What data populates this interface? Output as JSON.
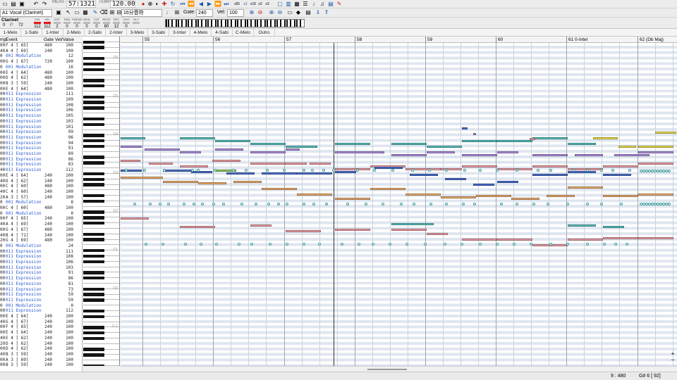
{
  "toolbar": {
    "measure": "57:1321",
    "tempo_label": "TEMPO",
    "tempo": "120.00",
    "meas_label": "MEAS",
    "step_select": "16分音符",
    "gate_label": "Gate:",
    "gate": "240",
    "vel_label": "Vel:",
    "vel": "100",
    "zoom_a": "x65",
    "zoom_b": "x1",
    "zoom_c": "x15",
    "zoom_d": "x2",
    "zoom_e": "x3"
  },
  "track": {
    "select": "A1 Vocal (Clarinet)",
    "name": "Clarinet",
    "num": "0",
    "port": "72",
    "meter_heads": [
      "VOL",
      "VEL",
      "EXP",
      "PAN",
      "P.BEND",
      "MOD",
      "CUT",
      "RESO",
      "REV",
      "CHO",
      "DLY"
    ],
    "meter_vals": [
      "112",
      "112",
      "2",
      "0",
      "0",
      "0",
      "0",
      "80",
      "12",
      "0",
      ""
    ]
  },
  "sections": [
    "1-Melo",
    "1-Sabi",
    "1-Inter",
    "2-Melo",
    "2-Sabi",
    "2-Inter",
    "3-Melo",
    "3-Sabi",
    "3-Inter",
    "4-Melo",
    "4-Sabi",
    "C-Melo",
    "Outro"
  ],
  "event_header": {
    "tick": "mp",
    "event": "Event",
    "gate": "Gate",
    "vel": "Vel/Value"
  },
  "events": [
    [
      "00",
      "F  4 [ 65]",
      "480",
      "100"
    ],
    [
      "40",
      "A  4 [ 69]",
      "240",
      "100"
    ],
    [
      "0",
      "001 Modulation",
      "",
      "12"
    ],
    [
      "00",
      "G  4 [ 67]",
      "720",
      "100"
    ],
    [
      "0",
      "001 Modulation",
      "",
      "16"
    ],
    [
      "00",
      "E  4 [ 64]",
      "480",
      "100"
    ],
    [
      "00",
      "D  4 [ 62]",
      "480",
      "100"
    ],
    [
      "00",
      "B  3 [ 59]",
      "240",
      "100"
    ],
    [
      "00",
      "E  4 [ 64]",
      "480",
      "100"
    ],
    [
      "00",
      "011 Expression",
      "",
      "111"
    ],
    [
      "00",
      "011 Expression",
      "",
      "109"
    ],
    [
      "00",
      "011 Expression",
      "",
      "108"
    ],
    [
      "00",
      "011 Expression",
      "",
      "106"
    ],
    [
      "00",
      "011 Expression",
      "",
      "105"
    ],
    [
      "00",
      "011 Expression",
      "",
      "103"
    ],
    [
      "00",
      "011 Expression",
      "",
      "101"
    ],
    [
      "00",
      "011 Expression",
      "",
      "99"
    ],
    [
      "00",
      "011 Expression",
      "",
      "96"
    ],
    [
      "00",
      "011 Expression",
      "",
      "94"
    ],
    [
      "00",
      "011 Expression",
      "",
      "91"
    ],
    [
      "00",
      "011 Expression",
      "",
      "89"
    ],
    [
      "00",
      "011 Expression",
      "",
      "86"
    ],
    [
      "00",
      "011 Expression",
      "",
      "83"
    ],
    [
      "40",
      "011 Expression",
      "",
      "112"
    ],
    [
      "00",
      "E  4 [ 64]",
      "240",
      "100"
    ],
    [
      "40",
      "D  4 [ 62]",
      "240",
      "100"
    ],
    [
      "00",
      "C  4 [ 60]",
      "480",
      "100"
    ],
    [
      "40",
      "C  4 [ 60]",
      "240",
      "100"
    ],
    [
      "20",
      "A  3 [ 57]",
      "240",
      "100"
    ],
    [
      "0",
      "001 Modulation",
      "",
      "8"
    ],
    [
      "00",
      "C  4 [ 60]",
      "480",
      "100"
    ],
    [
      "0",
      "001 Modulation",
      "",
      "0"
    ],
    [
      "00",
      "F  4 [ 65]",
      "240",
      "100"
    ],
    [
      "40",
      "A  4 [ 69]",
      "240",
      "100"
    ],
    [
      "00",
      "G  4 [ 67]",
      "480",
      "100"
    ],
    [
      "40",
      "B  4 [ 71]",
      "240",
      "100"
    ],
    [
      "20",
      "G  4 [ 69]",
      "480",
      "100"
    ],
    [
      "0",
      "001 Modulation",
      "",
      "24"
    ],
    [
      "00",
      "011 Expression",
      "",
      "111"
    ],
    [
      "00",
      "011 Expression",
      "",
      "108"
    ],
    [
      "00",
      "011 Expression",
      "",
      "106"
    ],
    [
      "00",
      "011 Expression",
      "",
      "103"
    ],
    [
      "00",
      "011 Expression",
      "",
      "91"
    ],
    [
      "00",
      "011 Expression",
      "",
      "86"
    ],
    [
      "00",
      "011 Expression",
      "",
      "81"
    ],
    [
      "00",
      "011 Expression",
      "",
      "73"
    ],
    [
      "00",
      "011 Expression",
      "",
      "59"
    ],
    [
      "00",
      "011 Expression",
      "",
      "59"
    ],
    [
      "0",
      "001 Modulation",
      "",
      "0"
    ],
    [
      "00",
      "011 Expression",
      "",
      "112"
    ],
    [
      "00",
      "E  4 [ 64]",
      "240",
      "100"
    ],
    [
      "40",
      "G  4 [ 67]",
      "240",
      "100"
    ],
    [
      "00",
      "F  4 [ 65]",
      "240",
      "100"
    ],
    [
      "00",
      "E  4 [ 64]",
      "240",
      "100"
    ],
    [
      "40",
      "E  4 [ 62]",
      "240",
      "100"
    ],
    [
      "20",
      "D  4 [ 62]",
      "240",
      "100"
    ],
    [
      "00",
      "D  4 [ 62]",
      "240",
      "100"
    ],
    [
      "40",
      "B  3 [ 59]",
      "240",
      "100"
    ],
    [
      "00",
      "A  3 [ 69]",
      "240",
      "100"
    ],
    [
      "00",
      "B  3 [ 59]",
      "240",
      "100"
    ]
  ],
  "ruler": [
    {
      "m": "55"
    },
    {
      "m": "56"
    },
    {
      "m": "57"
    },
    {
      "m": "58"
    },
    {
      "m": "59"
    },
    {
      "m": "60"
    },
    {
      "m": "61 0-Inter"
    },
    {
      "m": "62 (Db Maj)"
    }
  ],
  "octave_labels": [
    "C6",
    "C5",
    "C4",
    "C3",
    "C2",
    "C1",
    "C0",
    "C-1"
  ],
  "status": {
    "pos": "9 : 480",
    "pitch": "G# 6 [ 92]"
  },
  "colors": {
    "accent": "#1e58b0",
    "record": "#d81818",
    "note_teal": "#59c5c0",
    "note_pink": "#f0a0a8",
    "note_blue": "#4a6fd0",
    "note_orange": "#f0b070",
    "note_purple": "#b090e0",
    "note_yellow": "#f0e050"
  }
}
